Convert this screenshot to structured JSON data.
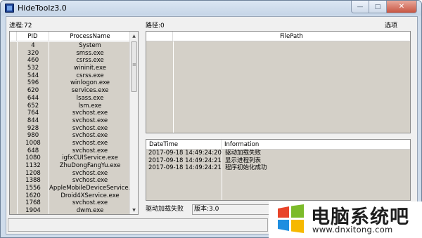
{
  "window": {
    "title": "HideToolz3.0"
  },
  "labels": {
    "process_count": "进程:72",
    "path": "路径:0",
    "options": "选项"
  },
  "process_table": {
    "columns": [
      "PID",
      "ProcessName"
    ],
    "rows": [
      [
        "4",
        "System"
      ],
      [
        "320",
        "smss.exe"
      ],
      [
        "460",
        "csrss.exe"
      ],
      [
        "532",
        "wininit.exe"
      ],
      [
        "544",
        "csrss.exe"
      ],
      [
        "596",
        "winlogon.exe"
      ],
      [
        "620",
        "services.exe"
      ],
      [
        "644",
        "lsass.exe"
      ],
      [
        "652",
        "lsm.exe"
      ],
      [
        "764",
        "svchost.exe"
      ],
      [
        "844",
        "svchost.exe"
      ],
      [
        "928",
        "svchost.exe"
      ],
      [
        "980",
        "svchost.exe"
      ],
      [
        "1008",
        "svchost.exe"
      ],
      [
        "648",
        "svchost.exe"
      ],
      [
        "1080",
        "igfxCUIService.exe"
      ],
      [
        "1132",
        "ZhuDongFangYu.exe"
      ],
      [
        "1208",
        "svchost.exe"
      ],
      [
        "1388",
        "svchost.exe"
      ],
      [
        "1556",
        "AppleMobileDeviceService..."
      ],
      [
        "1620",
        "Droid4XService.exe"
      ],
      [
        "1768",
        "svchost.exe"
      ],
      [
        "1904",
        "dwm.exe"
      ]
    ]
  },
  "file_table": {
    "columns": [
      "FilePath"
    ]
  },
  "log_table": {
    "columns": [
      "DateTime",
      "Information"
    ],
    "rows": [
      [
        "2017-09-18 14:49:24:204",
        "驱动加载失败"
      ],
      [
        "2017-09-18 14:49:24:214",
        "显示进程列表"
      ],
      [
        "2017-09-18 14:49:24:218",
        "程序初始化成功"
      ]
    ]
  },
  "status": {
    "driver_status": "驱动加载失败",
    "version": "版本:3.0"
  },
  "watermark": {
    "title": "电脑系统吧",
    "url": "www.dnxitong.com"
  },
  "colors": {
    "row_bg": "#d4d0c8",
    "window_frame": "#cfdceb",
    "logo_red": "#e8442a",
    "logo_green": "#7cbb2a",
    "logo_blue": "#1e8ee0",
    "logo_yellow": "#f6b800"
  }
}
